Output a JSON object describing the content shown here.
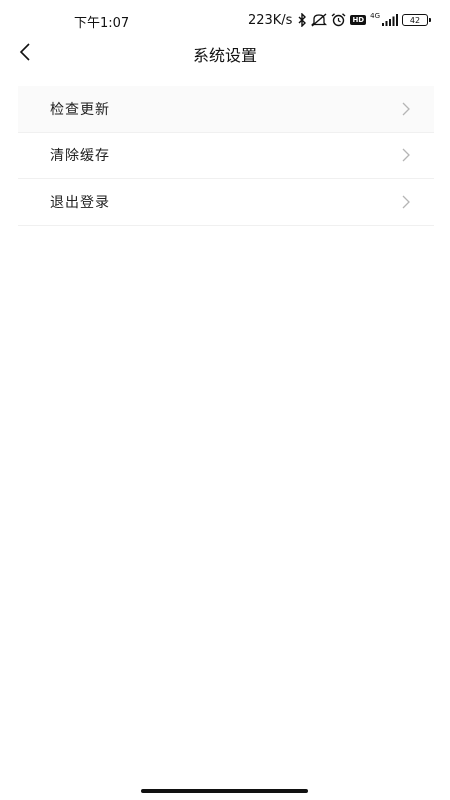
{
  "status_bar": {
    "time": "下午1:07",
    "net_speed": "223K/s",
    "hd_label": "HD",
    "network_type": "4G",
    "battery": "42"
  },
  "nav": {
    "title": "系统设置"
  },
  "settings": {
    "items": [
      {
        "label": "检查更新"
      },
      {
        "label": "清除缓存"
      },
      {
        "label": "退出登录"
      }
    ]
  }
}
